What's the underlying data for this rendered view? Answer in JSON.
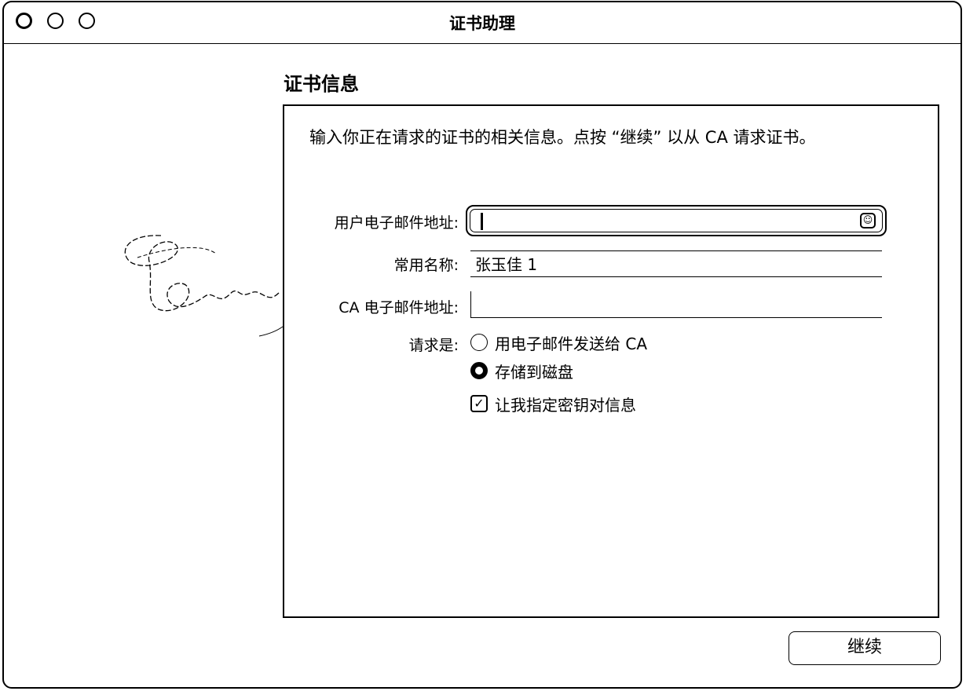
{
  "window": {
    "title": "证书助理"
  },
  "section_title": "证书信息",
  "intro_text": "输入你正在请求的证书的相关信息。点按 “继续” 以从 CA 请求证书。",
  "form": {
    "user_email_label": "用户电子邮件地址:",
    "user_email_value": "",
    "common_name_label": "常用名称:",
    "common_name_value": "张玉佳 1",
    "ca_email_label": "CA 电子邮件地址:",
    "ca_email_value": "",
    "request_label": "请求是:",
    "request_options": [
      {
        "label": "用电子邮件发送给 CA",
        "selected": false
      },
      {
        "label": "存储到磁盘",
        "selected": true
      }
    ],
    "specify_key_label": "让我指定密钥对信息",
    "specify_key_checked": true
  },
  "buttons": {
    "continue_label": "继续"
  },
  "icons": {
    "contacts": "contact-card-icon",
    "check": "checkmark-icon"
  }
}
